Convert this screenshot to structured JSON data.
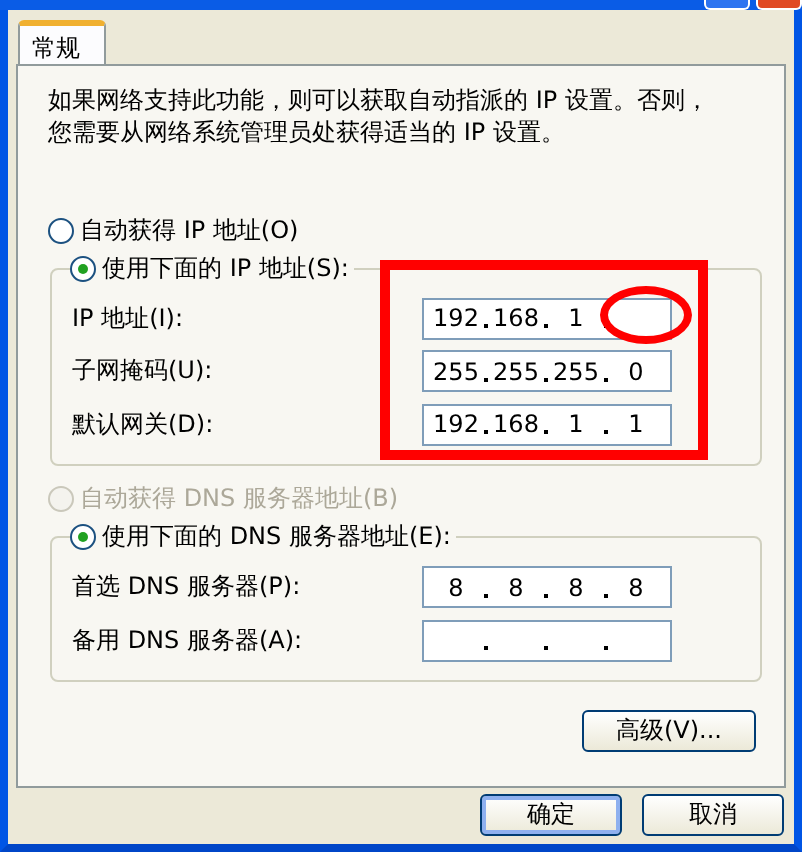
{
  "window": {
    "title_bar_buttons": [
      {
        "kind": "plain"
      },
      {
        "kind": "close"
      }
    ]
  },
  "tabs": [
    {
      "label": "常规",
      "selected": true
    }
  ],
  "description": [
    "如果网络支持此功能，则可以获取自动指派的 IP 设置。否则，",
    "您需要从网络系统管理员处获得适当的 IP 设置。"
  ],
  "ip_section": {
    "options": [
      {
        "label": "自动获得 IP 地址(O)",
        "selected": false,
        "disabled": false
      },
      {
        "label": "使用下面的 IP 地址(S):",
        "selected": true,
        "disabled": false
      }
    ],
    "fields": [
      {
        "label": "IP 地址(I):",
        "octets": [
          "192",
          "168",
          "1"
        ]
      },
      {
        "label": "子网掩码(U):",
        "octets": [
          "255",
          "255",
          "255",
          "0"
        ]
      },
      {
        "label": "默认网关(D):",
        "octets": [
          "192",
          "168",
          "1",
          "1"
        ]
      }
    ]
  },
  "dns_section": {
    "options": [
      {
        "label": "自动获得 DNS 服务器地址(B)",
        "selected": false,
        "disabled": true
      },
      {
        "label": "使用下面的 DNS 服务器地址(E):",
        "selected": true,
        "disabled": false
      }
    ],
    "fields": [
      {
        "label": "首选 DNS 服务器(P):",
        "octets": [
          "8",
          "8",
          "8",
          "8"
        ]
      },
      {
        "label": "备用 DNS 服务器(A):"
      }
    ]
  },
  "advanced_button": "高级(V)...",
  "dialog_buttons": [
    {
      "label": "确定",
      "default": true
    },
    {
      "label": "取消",
      "default": false
    }
  ]
}
